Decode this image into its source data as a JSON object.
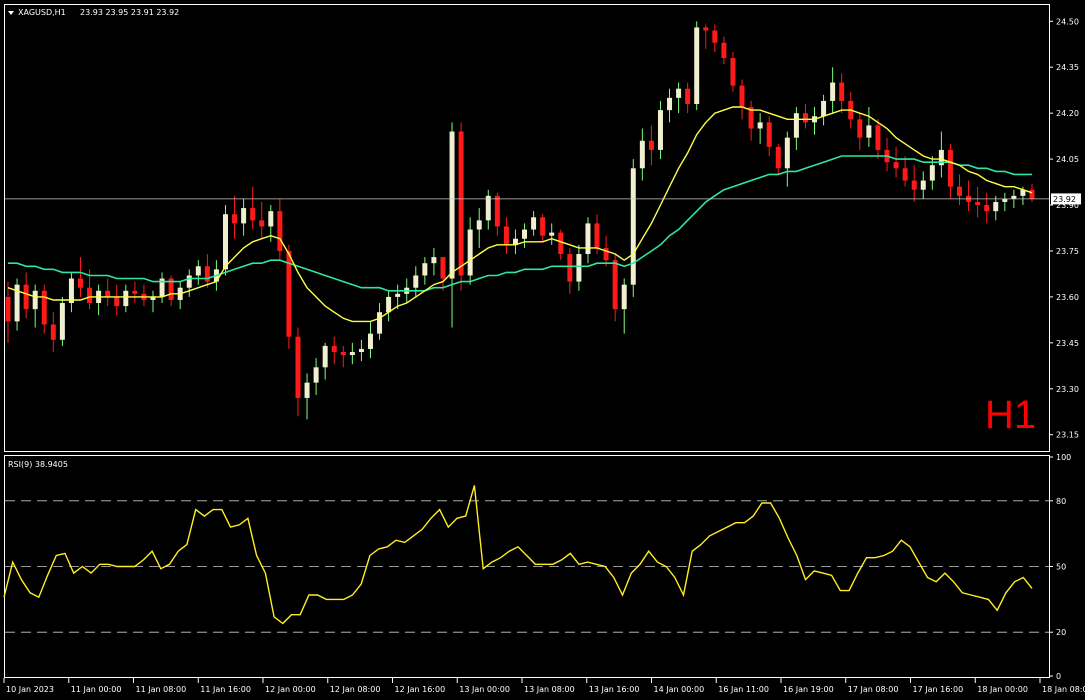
{
  "header": {
    "symbol": "XAGUSD,H1",
    "ohlc": "23.93 23.95 23.91 23.92"
  },
  "timeframe_label": "H1",
  "rsi_label": "RSI(9) 38.9405",
  "current_price_label": "23.92",
  "colors": {
    "background": "#000000",
    "bull": "#f0f0d0",
    "bear": "#ff1a1a",
    "doji": "#7cff7c",
    "ma_fast": "#ffff44",
    "ma_slow": "#2ee6a0",
    "rsi": "#ffee22",
    "axes": "#ffffff",
    "level_lines": "#c8c8c8",
    "h1_label": "#ff0000"
  },
  "chart_data": [
    {
      "type": "candlestick",
      "symbol": "XAGUSD",
      "timeframe": "H1",
      "ylim": [
        23.1,
        24.55
      ],
      "y_ticks": [
        "24.50",
        "24.35",
        "24.20",
        "24.05",
        "23.90",
        "23.75",
        "23.60",
        "23.45",
        "23.30",
        "23.15"
      ],
      "x_ticks": [
        "10 Jan 2023",
        "11 Jan 00:00",
        "11 Jan 08:00",
        "11 Jan 16:00",
        "12 Jan 00:00",
        "12 Jan 08:00",
        "12 Jan 16:00",
        "13 Jan 00:00",
        "13 Jan 08:00",
        "13 Jan 16:00",
        "14 Jan 00:00",
        "16 Jan 11:00",
        "16 Jan 19:00",
        "17 Jan 08:00",
        "17 Jan 16:00",
        "18 Jan 00:00",
        "18 Jan 08:00"
      ],
      "candles": [
        [
          23.6,
          23.65,
          23.45,
          23.52
        ],
        [
          23.52,
          23.66,
          23.49,
          23.64
        ],
        [
          23.64,
          23.68,
          23.53,
          23.56
        ],
        [
          23.56,
          23.64,
          23.5,
          23.62
        ],
        [
          23.62,
          23.64,
          23.48,
          23.51
        ],
        [
          23.51,
          23.55,
          23.42,
          23.46
        ],
        [
          23.46,
          23.6,
          23.44,
          23.58
        ],
        [
          23.58,
          23.68,
          23.55,
          23.66
        ],
        [
          23.66,
          23.73,
          23.6,
          23.63
        ],
        [
          23.63,
          23.69,
          23.56,
          23.58
        ],
        [
          23.58,
          23.64,
          23.54,
          23.62
        ],
        [
          23.62,
          23.66,
          23.57,
          23.6
        ],
        [
          23.6,
          23.64,
          23.54,
          23.57
        ],
        [
          23.57,
          23.64,
          23.55,
          23.62
        ],
        [
          23.62,
          23.65,
          23.58,
          23.61
        ],
        [
          23.61,
          23.64,
          23.57,
          23.59
        ],
        [
          23.59,
          23.62,
          23.55,
          23.6
        ],
        [
          23.6,
          23.68,
          23.58,
          23.66
        ],
        [
          23.66,
          23.67,
          23.57,
          23.59
        ],
        [
          23.59,
          23.65,
          23.56,
          23.63
        ],
        [
          23.63,
          23.69,
          23.6,
          23.67
        ],
        [
          23.67,
          23.72,
          23.64,
          23.7
        ],
        [
          23.7,
          23.74,
          23.63,
          23.65
        ],
        [
          23.65,
          23.72,
          23.62,
          23.69
        ],
        [
          23.69,
          23.9,
          23.67,
          23.87
        ],
        [
          23.87,
          23.93,
          23.79,
          23.84
        ],
        [
          23.84,
          23.92,
          23.8,
          23.89
        ],
        [
          23.89,
          23.96,
          23.82,
          23.85
        ],
        [
          23.85,
          23.91,
          23.79,
          23.83
        ],
        [
          23.83,
          23.9,
          23.78,
          23.88
        ],
        [
          23.88,
          23.92,
          23.72,
          23.75
        ],
        [
          23.75,
          23.77,
          23.43,
          23.47
        ],
        [
          23.47,
          23.5,
          23.21,
          23.27
        ],
        [
          23.27,
          23.35,
          23.2,
          23.32
        ],
        [
          23.32,
          23.4,
          23.28,
          23.37
        ],
        [
          23.37,
          23.45,
          23.33,
          23.44
        ],
        [
          23.44,
          23.47,
          23.38,
          23.42
        ],
        [
          23.42,
          23.44,
          23.37,
          23.41
        ],
        [
          23.41,
          23.45,
          23.38,
          23.42
        ],
        [
          23.42,
          23.46,
          23.39,
          23.43
        ],
        [
          23.43,
          23.52,
          23.4,
          23.48
        ],
        [
          23.48,
          23.58,
          23.46,
          23.55
        ],
        [
          23.55,
          23.62,
          23.52,
          23.6
        ],
        [
          23.6,
          23.64,
          23.56,
          23.61
        ],
        [
          23.61,
          23.66,
          23.58,
          23.63
        ],
        [
          23.63,
          23.7,
          23.6,
          23.67
        ],
        [
          23.67,
          23.73,
          23.64,
          23.71
        ],
        [
          23.71,
          23.76,
          23.67,
          23.73
        ],
        [
          23.73,
          23.72,
          23.62,
          23.66
        ],
        [
          23.66,
          24.17,
          23.5,
          24.14
        ],
        [
          24.14,
          24.17,
          23.62,
          23.67
        ],
        [
          23.67,
          23.86,
          23.64,
          23.82
        ],
        [
          23.82,
          23.89,
          23.76,
          23.85
        ],
        [
          23.85,
          23.95,
          23.82,
          23.93
        ],
        [
          23.93,
          23.94,
          23.8,
          23.83
        ],
        [
          23.83,
          23.86,
          23.74,
          23.77
        ],
        [
          23.77,
          23.82,
          23.74,
          23.79
        ],
        [
          23.79,
          23.84,
          23.76,
          23.82
        ],
        [
          23.82,
          23.88,
          23.8,
          23.86
        ],
        [
          23.86,
          23.87,
          23.78,
          23.8
        ],
        [
          23.8,
          23.84,
          23.77,
          23.81
        ],
        [
          23.81,
          23.82,
          23.72,
          23.74
        ],
        [
          23.74,
          23.76,
          23.61,
          23.65
        ],
        [
          23.65,
          23.77,
          23.62,
          23.74
        ],
        [
          23.74,
          23.86,
          23.71,
          23.84
        ],
        [
          23.84,
          23.87,
          23.74,
          23.76
        ],
        [
          23.76,
          23.8,
          23.7,
          23.72
        ],
        [
          23.72,
          23.74,
          23.52,
          23.56
        ],
        [
          23.56,
          23.66,
          23.48,
          23.64
        ],
        [
          23.64,
          24.05,
          23.6,
          24.02
        ],
        [
          24.02,
          24.15,
          23.98,
          24.11
        ],
        [
          24.11,
          24.16,
          24.03,
          24.08
        ],
        [
          24.08,
          24.24,
          24.05,
          24.21
        ],
        [
          24.21,
          24.28,
          24.17,
          24.25
        ],
        [
          24.25,
          24.3,
          24.2,
          24.28
        ],
        [
          24.28,
          24.3,
          24.2,
          24.23
        ],
        [
          24.23,
          24.5,
          24.21,
          24.48
        ],
        [
          24.48,
          24.49,
          24.41,
          24.47
        ],
        [
          24.47,
          24.49,
          24.4,
          24.43
        ],
        [
          24.43,
          24.45,
          24.36,
          24.38
        ],
        [
          24.38,
          24.4,
          24.27,
          24.29
        ],
        [
          24.29,
          24.31,
          24.18,
          24.22
        ],
        [
          24.22,
          24.24,
          24.11,
          24.15
        ],
        [
          24.15,
          24.2,
          24.1,
          24.17
        ],
        [
          24.17,
          24.19,
          24.06,
          24.09
        ],
        [
          24.09,
          24.1,
          24.0,
          24.02
        ],
        [
          24.02,
          24.14,
          23.96,
          24.12
        ],
        [
          24.12,
          24.22,
          24.08,
          24.2
        ],
        [
          24.2,
          24.23,
          24.15,
          24.17
        ],
        [
          24.17,
          24.22,
          24.13,
          24.19
        ],
        [
          24.19,
          24.26,
          24.16,
          24.24
        ],
        [
          24.24,
          24.35,
          24.2,
          24.3
        ],
        [
          24.3,
          24.33,
          24.2,
          24.24
        ],
        [
          24.24,
          24.27,
          24.15,
          24.18
        ],
        [
          24.18,
          24.2,
          24.08,
          24.12
        ],
        [
          24.12,
          24.22,
          24.09,
          24.16
        ],
        [
          24.16,
          24.18,
          24.05,
          24.08
        ],
        [
          24.08,
          24.12,
          24.01,
          24.04
        ],
        [
          24.04,
          24.09,
          23.99,
          24.02
        ],
        [
          24.02,
          24.06,
          23.96,
          23.98
        ],
        [
          23.98,
          24.03,
          23.91,
          23.95
        ],
        [
          23.95,
          24.01,
          23.92,
          23.98
        ],
        [
          23.98,
          24.06,
          23.95,
          24.03
        ],
        [
          24.03,
          24.14,
          23.99,
          24.08
        ],
        [
          24.08,
          24.1,
          23.92,
          23.96
        ],
        [
          23.96,
          24.0,
          23.9,
          23.93
        ],
        [
          23.93,
          23.98,
          23.88,
          23.91
        ],
        [
          23.91,
          23.96,
          23.86,
          23.9
        ],
        [
          23.9,
          23.94,
          23.84,
          23.88
        ],
        [
          23.88,
          23.93,
          23.85,
          23.91
        ],
        [
          23.91,
          23.94,
          23.88,
          23.92
        ],
        [
          23.92,
          23.95,
          23.89,
          23.93
        ],
        [
          23.93,
          23.96,
          23.9,
          23.95
        ],
        [
          23.95,
          23.97,
          23.91,
          23.92
        ]
      ],
      "ma_fast": [
        23.63,
        23.62,
        23.61,
        23.6,
        23.6,
        23.59,
        23.59,
        23.59,
        23.59,
        23.6,
        23.6,
        23.6,
        23.6,
        23.6,
        23.6,
        23.6,
        23.6,
        23.6,
        23.61,
        23.61,
        23.62,
        23.63,
        23.64,
        23.65,
        23.7,
        23.73,
        23.76,
        23.78,
        23.79,
        23.8,
        23.79,
        23.74,
        23.68,
        23.63,
        23.6,
        23.57,
        23.55,
        23.53,
        23.52,
        23.52,
        23.52,
        23.53,
        23.55,
        23.57,
        23.58,
        23.6,
        23.62,
        23.64,
        23.65,
        23.68,
        23.7,
        23.72,
        23.74,
        23.76,
        23.77,
        23.77,
        23.77,
        23.78,
        23.78,
        23.78,
        23.79,
        23.78,
        23.77,
        23.76,
        23.76,
        23.76,
        23.75,
        23.74,
        23.72,
        23.74,
        23.79,
        23.84,
        23.9,
        23.96,
        24.02,
        24.07,
        24.13,
        24.17,
        24.2,
        24.21,
        24.22,
        24.22,
        24.21,
        24.21,
        24.2,
        24.19,
        24.18,
        24.18,
        24.18,
        24.18,
        24.19,
        24.2,
        24.21,
        24.21,
        24.2,
        24.19,
        24.17,
        24.15,
        24.12,
        24.1,
        24.08,
        24.06,
        24.05,
        24.05,
        24.04,
        24.03,
        24.01,
        24.0,
        23.98,
        23.97,
        23.96,
        23.96,
        23.95,
        23.94
      ],
      "ma_slow": [
        23.71,
        23.71,
        23.7,
        23.7,
        23.69,
        23.69,
        23.68,
        23.68,
        23.68,
        23.67,
        23.67,
        23.67,
        23.66,
        23.66,
        23.66,
        23.66,
        23.65,
        23.65,
        23.65,
        23.65,
        23.66,
        23.66,
        23.66,
        23.67,
        23.68,
        23.69,
        23.7,
        23.71,
        23.71,
        23.72,
        23.72,
        23.71,
        23.7,
        23.69,
        23.68,
        23.67,
        23.66,
        23.65,
        23.64,
        23.63,
        23.63,
        23.63,
        23.62,
        23.62,
        23.62,
        23.62,
        23.62,
        23.63,
        23.63,
        23.64,
        23.65,
        23.65,
        23.66,
        23.67,
        23.67,
        23.68,
        23.68,
        23.69,
        23.69,
        23.69,
        23.7,
        23.7,
        23.7,
        23.7,
        23.7,
        23.71,
        23.71,
        23.71,
        23.7,
        23.71,
        23.73,
        23.75,
        23.77,
        23.8,
        23.82,
        23.85,
        23.88,
        23.91,
        23.93,
        23.95,
        23.96,
        23.97,
        23.98,
        23.99,
        24.0,
        24.0,
        24.01,
        24.01,
        24.02,
        24.03,
        24.04,
        24.05,
        24.06,
        24.06,
        24.06,
        24.06,
        24.06,
        24.06,
        24.05,
        24.05,
        24.05,
        24.04,
        24.04,
        24.04,
        24.04,
        24.03,
        24.03,
        24.02,
        24.02,
        24.01,
        24.01,
        24.0,
        24.0,
        24.0
      ]
    },
    {
      "type": "line",
      "name": "RSI(9)",
      "ylim": [
        0,
        100
      ],
      "y_ticks": [
        "100",
        "80",
        "50",
        "20",
        "0"
      ],
      "levels": [
        80,
        50,
        20
      ],
      "values": [
        36,
        52,
        44,
        38,
        36,
        46,
        55,
        56,
        47,
        50,
        47,
        51,
        51,
        50,
        50,
        50,
        53,
        57,
        49,
        51,
        57,
        60,
        76,
        73,
        76,
        76,
        68,
        69,
        72,
        55,
        47,
        27,
        24,
        28,
        28,
        37,
        37,
        35,
        35,
        35,
        37,
        42,
        55,
        58,
        59,
        62,
        61,
        64,
        67,
        72,
        76,
        68,
        72,
        73,
        87,
        49,
        52,
        54,
        57,
        59,
        55,
        51,
        51,
        51,
        53,
        56,
        51,
        52,
        51,
        50,
        45,
        37,
        47,
        51,
        57,
        52,
        50,
        45,
        37,
        57,
        60,
        64,
        66,
        68,
        70,
        70,
        73,
        79,
        79,
        72,
        63,
        55,
        44,
        48,
        47,
        46,
        39,
        39,
        47,
        54,
        54,
        55,
        57,
        62,
        59,
        52,
        45,
        43,
        47,
        43,
        38,
        37,
        36,
        35,
        30,
        38,
        43,
        45,
        40
      ]
    }
  ]
}
